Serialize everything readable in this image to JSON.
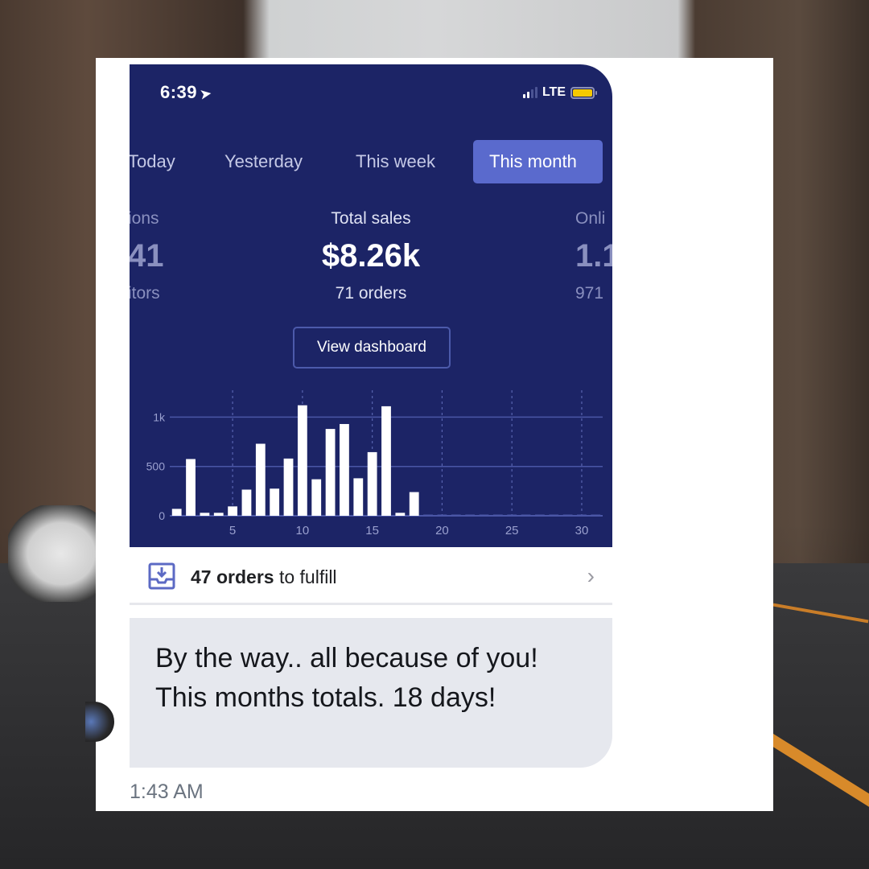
{
  "status_bar": {
    "time": "6:39",
    "location_icon": "location-arrow-icon",
    "signal_bars_filled": 2,
    "signal_bars_total": 4,
    "network": "LTE",
    "battery_color": "#f5c900"
  },
  "tabs": [
    {
      "label": "Today",
      "active": false
    },
    {
      "label": "Yesterday",
      "active": false
    },
    {
      "label": "This week",
      "active": false
    },
    {
      "label": "This month",
      "active": true
    }
  ],
  "metrics": {
    "left": {
      "label": "ions",
      "value": "41",
      "sub": "itors"
    },
    "center": {
      "label": "Total sales",
      "value": "$8.26k",
      "sub": "71 orders"
    },
    "right": {
      "label": "Onli",
      "value": "1.1",
      "sub": "971"
    }
  },
  "view_dashboard_label": "View dashboard",
  "chart_data": {
    "type": "bar",
    "title": "",
    "xlabel": "",
    "ylabel": "",
    "x": [
      1,
      2,
      3,
      4,
      5,
      6,
      7,
      8,
      9,
      10,
      11,
      12,
      13,
      14,
      15,
      16,
      17,
      18,
      19,
      20,
      21,
      22,
      23,
      24,
      25,
      26,
      27,
      28,
      29,
      30,
      31
    ],
    "values": [
      70,
      575,
      30,
      30,
      95,
      265,
      730,
      275,
      580,
      1120,
      370,
      880,
      930,
      380,
      645,
      1110,
      30,
      240,
      5,
      5,
      5,
      5,
      5,
      5,
      5,
      5,
      5,
      5,
      5,
      5,
      5
    ],
    "x_ticks": [
      "5",
      "10",
      "15",
      "20",
      "25",
      "30"
    ],
    "x_tick_values": [
      5,
      10,
      15,
      20,
      25,
      30
    ],
    "y_ticks": [
      "0",
      "500",
      "1k"
    ],
    "y_tick_values": [
      0,
      500,
      1000
    ],
    "ylim": [
      0,
      1150
    ],
    "grid": true,
    "bar_color": "#ffffff",
    "background": "#1c2466"
  },
  "fulfill": {
    "icon": "inbox-download-icon",
    "count_text": "47 orders",
    "suffix_text": " to fulfill",
    "chevron": "›"
  },
  "message": {
    "text": "By the way.. all because of you! This months totals. 18 days!",
    "timestamp": "1:43 AM"
  },
  "colors": {
    "phone_bg": "#1c2466",
    "active_tab": "#5a6acd",
    "accent_icon": "#5c6ac4",
    "bubble_bg": "#e6e8ee"
  }
}
